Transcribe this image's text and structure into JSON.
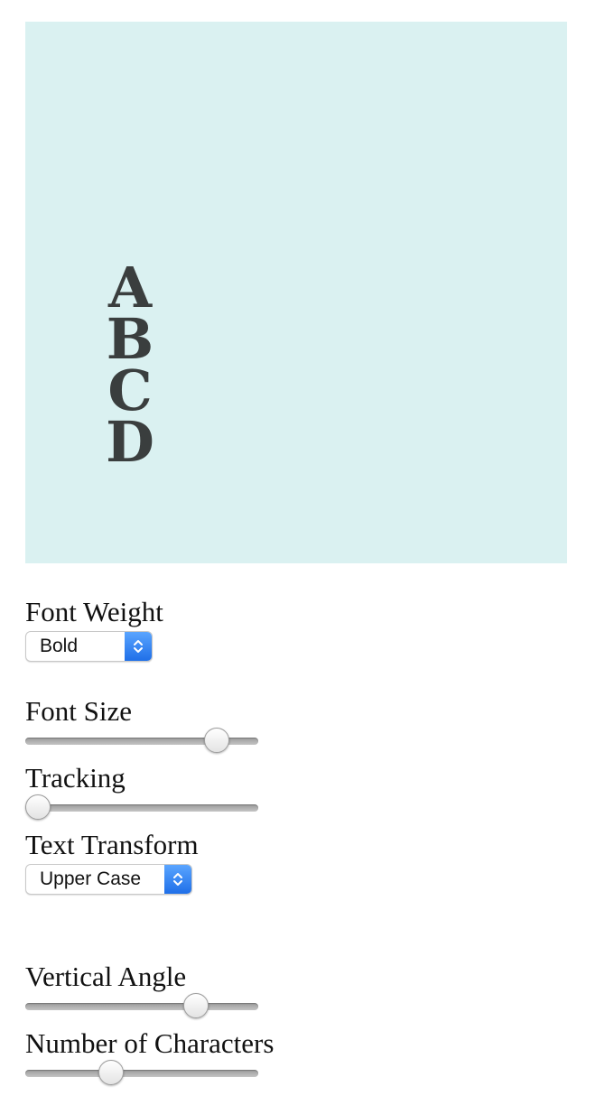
{
  "preview": {
    "letters": [
      "A",
      "B",
      "C",
      "D"
    ],
    "background_color": "#daf1f1",
    "text_color": "#3a3e3e"
  },
  "controls": {
    "font_weight": {
      "label": "Font Weight",
      "value": "Bold",
      "icon": "up-down-chevron-icon"
    },
    "font_size": {
      "label": "Font Size",
      "value_fraction": 0.86
    },
    "tracking": {
      "label": "Tracking",
      "value_fraction": 0.0
    },
    "text_transform": {
      "label": "Text Transform",
      "value": "Upper Case",
      "icon": "up-down-chevron-icon"
    },
    "vertical_angle": {
      "label": "Vertical Angle",
      "value_fraction": 0.76
    },
    "number_of_characters": {
      "label": "Number of Characters",
      "value_fraction": 0.35
    }
  }
}
